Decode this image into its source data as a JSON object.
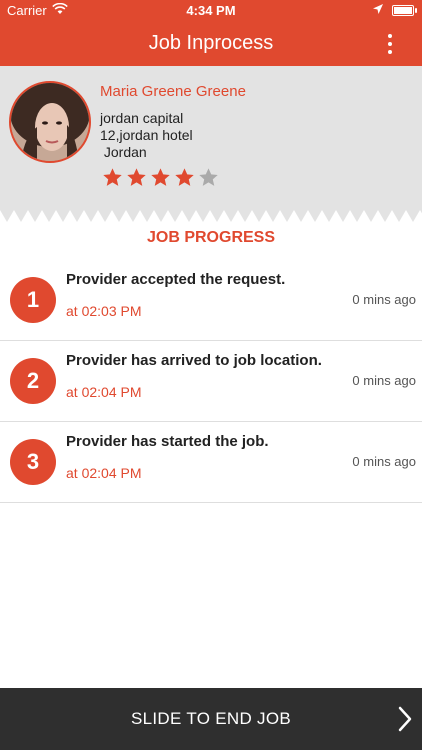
{
  "status_bar": {
    "carrier": "Carrier",
    "time": "4:34 PM"
  },
  "header": {
    "title": "Job Inprocess",
    "menu_icon": "more-vertical-icon"
  },
  "provider": {
    "name": "Maria Greene Greene",
    "address_line1": "jordan capital",
    "address_line2": "12,jordan hotel",
    "address_line3": " Jordan",
    "rating": 4,
    "rating_max": 5
  },
  "progress": {
    "title": "JOB PROGRESS",
    "steps": [
      {
        "number": "1",
        "title": "Provider accepted the request.",
        "time": "at 02:03 PM",
        "ago": "0 mins ago"
      },
      {
        "number": "2",
        "title": "Provider has arrived to job location.",
        "time": "at 02:04 PM",
        "ago": "0 mins ago"
      },
      {
        "number": "3",
        "title": "Provider has started the job.",
        "time": "at 02:04 PM",
        "ago": "0 mins ago"
      }
    ]
  },
  "slide": {
    "label": "SLIDE TO END JOB"
  },
  "colors": {
    "accent": "#e0492f",
    "profile_bg": "#e3e3e3",
    "slider_bg": "#2f2f2f",
    "star_inactive": "#aaaaaa"
  }
}
